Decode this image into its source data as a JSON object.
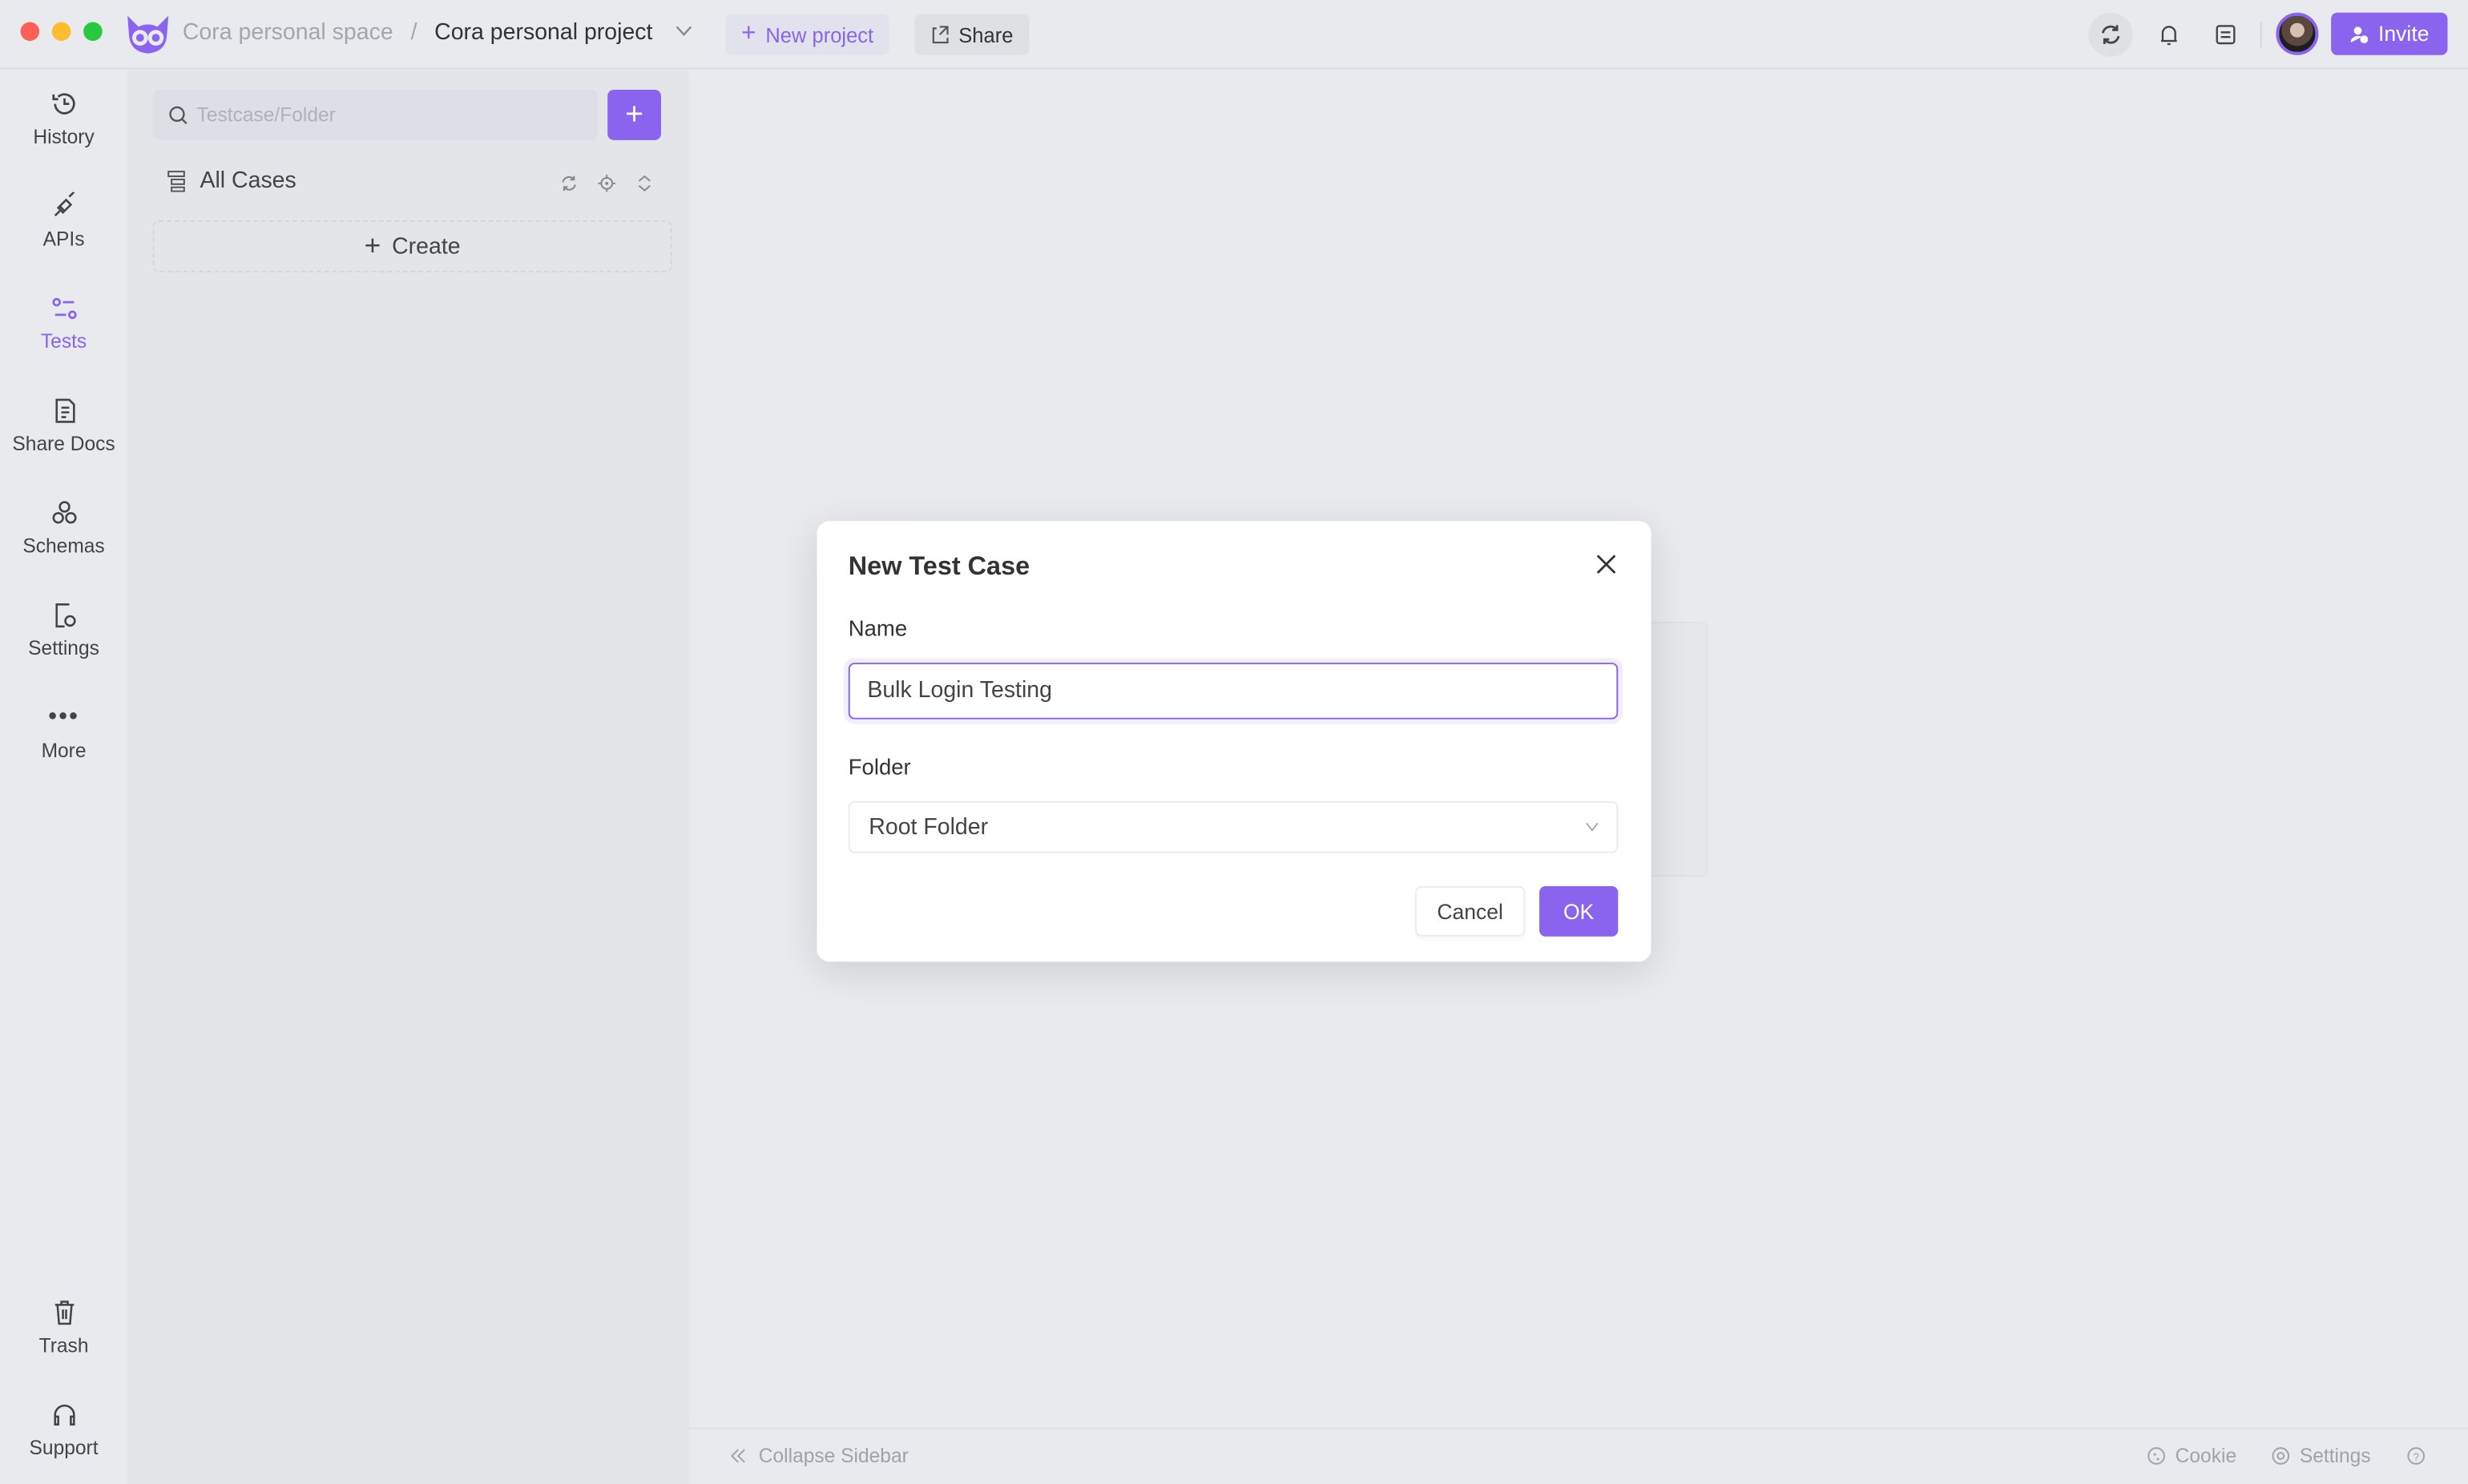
{
  "titlebar": {
    "workspace": "Cora personal space",
    "separator": "/",
    "project": "Cora personal project",
    "new_project_label": "New project",
    "share_label": "Share",
    "invite_label": "Invite"
  },
  "rail": {
    "items": [
      {
        "label": "History",
        "icon": "history-icon"
      },
      {
        "label": "APIs",
        "icon": "plug-icon"
      },
      {
        "label": "Tests",
        "icon": "tests-icon",
        "active": true
      },
      {
        "label": "Share Docs",
        "icon": "docs-icon"
      },
      {
        "label": "Schemas",
        "icon": "schemas-icon"
      },
      {
        "label": "Settings",
        "icon": "settings-icon"
      },
      {
        "label": "More",
        "icon": "more-icon"
      }
    ],
    "bottom": [
      {
        "label": "Trash",
        "icon": "trash-icon"
      },
      {
        "label": "Support",
        "icon": "headset-icon"
      }
    ]
  },
  "panel": {
    "search_placeholder": "Testcase/Folder",
    "all_cases_label": "All Cases",
    "create_label": "Create"
  },
  "footer": {
    "collapse_label": "Collapse Sidebar",
    "cookie_label": "Cookie",
    "settings_label": "Settings"
  },
  "modal": {
    "title": "New Test Case",
    "name_label": "Name",
    "name_value": "Bulk Login Testing",
    "folder_label": "Folder",
    "folder_value": "Root Folder",
    "cancel_label": "Cancel",
    "ok_label": "OK"
  },
  "colors": {
    "accent": "#8a63ee",
    "background": "#e9eaee",
    "panel": "#e4e5e9"
  }
}
